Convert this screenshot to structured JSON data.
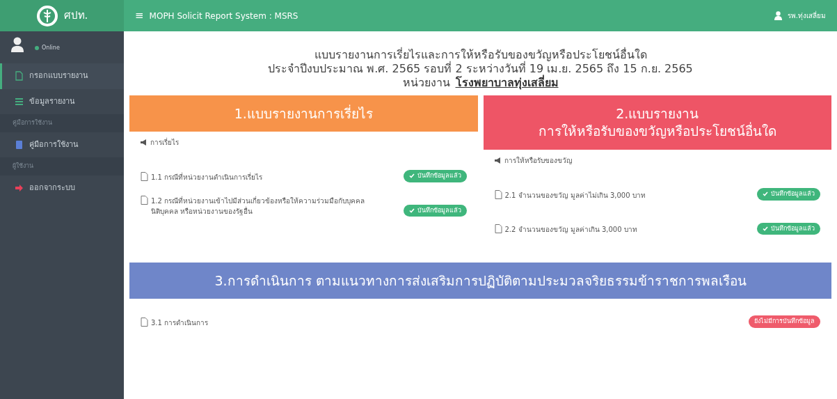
{
  "brand": {
    "name": "ศปท."
  },
  "topbar": {
    "menu_glyph": "≡",
    "title": "MOPH Solicit Report System : MSRS",
    "user": "รพ.ทุ่งเสลี่ยม"
  },
  "sidebar": {
    "status": "Online",
    "items": [
      {
        "kind": "link",
        "label": "กรอกแบบรายงาน",
        "selected": true
      },
      {
        "kind": "link",
        "label": "ข้อมูลรายงาน",
        "selected": false
      },
      {
        "kind": "header",
        "label": "คู่มือการใช้งาน"
      },
      {
        "kind": "link",
        "label": "คู่มือการใช้งาน",
        "selected": false
      },
      {
        "kind": "header",
        "label": "ผู้ใช้งาน"
      },
      {
        "kind": "link",
        "label": "ออกจากระบบ",
        "selected": false
      }
    ]
  },
  "heading": {
    "lines": [
      "แบบรายงานการเรี่ยไรและการให้หรือรับของขวัญหรือประโยชน์อื่นใด",
      "ประจำปีงบประมาณ พ.ศ. 2565 รอบที่ 2 ระหว่างวันที่ 19 เม.ย. 2565 ถึง 15 ก.ย. 2565"
    ],
    "unit_label": "หน่วยงาน",
    "unit_name": "โรงพยาบาลทุ่งเสลี่ยม"
  },
  "sections": [
    {
      "color": "#f7934a",
      "title": [
        "1.แบบรายงานการเรี่ยไร"
      ],
      "subheading": "การเรี่ยไร",
      "items": [
        {
          "label": "1.1 กรณีที่หน่วยงานดำเนินการเรี่ยไร",
          "saved": true,
          "status": "บันทึกข้อมูลแล้ว"
        },
        {
          "label": "1.2 กรณีที่หน่วยงานเข้าไปมีส่วนเกี่ยวข้องหรือให้ความร่วมมือกับบุคคล นิติบุคคล หรือหน่วยงานของรัฐอื่น",
          "saved": true,
          "status": "บันทึกข้อมูลแล้ว"
        }
      ]
    },
    {
      "color": "#ee5566",
      "title": [
        "2.แบบรายงาน",
        "การให้หรือรับของขวัญหรือประโยชน์อื่นใด"
      ],
      "subheading": "การให้หรือรับของขวัญ",
      "items": [
        {
          "label": "2.1 จำนวนของขวัญ มูลค่าไม่เกิน 3,000 บาท",
          "saved": true,
          "status": "บันทึกข้อมูลแล้ว"
        },
        {
          "label": "2.2 จำนวนของขวัญ มูลค่าเกิน 3,000 บาท",
          "saved": true,
          "status": "บันทึกข้อมูลแล้ว"
        }
      ]
    },
    {
      "color": "#6f86c9",
      "title": [
        "3.การดำเนินการ ตามแนวทางการส่งเสริมการปฏิบัติตามประมวลจริยธรรมข้าราชการพลเรือน"
      ],
      "items": [
        {
          "label": "3.1 การดำเนินการ",
          "saved": false,
          "status": "ยังไม่มีการบันทึกข้อมูล"
        }
      ]
    }
  ]
}
